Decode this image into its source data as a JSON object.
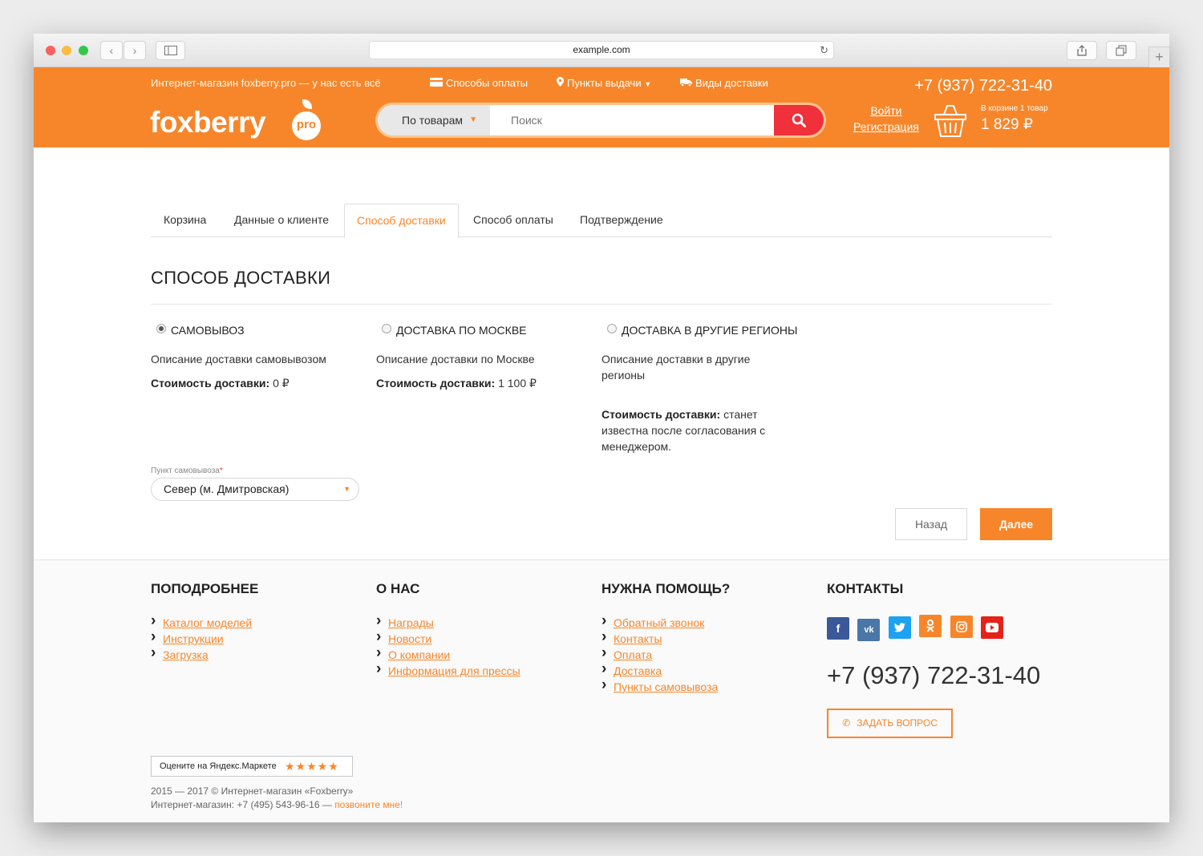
{
  "browser": {
    "url": "example.com"
  },
  "header": {
    "tagline": "Интернет-магазин foxberry.pro — у нас есть всё",
    "nav": {
      "payment": "Способы оплаты",
      "pickup": "Пункты выдачи",
      "delivery": "Виды доставки"
    },
    "phone": "+7 (937) 722-31-40",
    "logo": "foxberry",
    "logo_badge": "pro",
    "search": {
      "category": "По товарам",
      "placeholder": "Поиск"
    },
    "auth": {
      "login": "Войти",
      "register": "Регистрация"
    },
    "cart": {
      "label": "В корзине 1 товар",
      "sum": "1 829 ₽"
    }
  },
  "checkout": {
    "steps": [
      "Корзина",
      "Данные о клиенте",
      "Способ доставки",
      "Способ оплаты",
      "Подтверждение"
    ],
    "active_step": "Способ доставки",
    "heading": "СПОСОБ ДОСТАВКИ",
    "options": [
      {
        "title": "САМОВЫВОЗ",
        "selected": true,
        "description": "Описание доставки самовывозом",
        "cost_label": "Стоимость доставки:",
        "cost": "0 ₽"
      },
      {
        "title": "ДОСТАВКА ПО МОСКВЕ",
        "selected": false,
        "description": "Описание доставки по Москве",
        "cost_label": "Стоимость доставки:",
        "cost": "1 100 ₽"
      },
      {
        "title": "ДОСТАВКА В ДРУГИЕ РЕГИОНЫ",
        "selected": false,
        "description": "Описание доставки в другие регионы",
        "cost_label": "Стоимость доставки:",
        "cost": "станет известна после согласования с менеджером."
      }
    ],
    "pickup_label": "Пункт самовывоза",
    "pickup_required": "*",
    "pickup_value": "Север (м. Дмитровская)",
    "back_button": "Назад",
    "next_button": "Далее"
  },
  "footer": {
    "col1": {
      "title": "ПОПОДРОБНЕЕ",
      "links": [
        "Каталог моделей",
        "Инструкции",
        "Загрузка"
      ]
    },
    "col2": {
      "title": "О НАС",
      "links": [
        "Награды",
        "Новости",
        "О компании",
        "Информация для прессы"
      ]
    },
    "col3": {
      "title": "НУЖНА ПОМОЩЬ?",
      "links": [
        "Обратный звонок",
        "Контакты",
        "Оплата",
        "Доставка",
        "Пункты самовывоза"
      ]
    },
    "contacts": {
      "title": "КОНТАКТЫ",
      "socials": [
        "facebook",
        "vk",
        "twitter",
        "odnoklassniki",
        "instagram",
        "youtube"
      ],
      "phone": "+7 (937) 722-31-40",
      "ask_button": "ЗАДАТЬ ВОПРОС"
    },
    "rating_badge": "Оцените на Яндекс.Маркете",
    "rating_stars": "★★★★★",
    "copyright": "2015 — 2017 © Интернет-магазин «Foxberry»",
    "shop_phone": "Интернет-магазин: +7 (495) 543-96-16 —",
    "call_me": "позвоните мне!"
  },
  "colors": {
    "accent": "#f7862b",
    "search_button": "#f0303a"
  }
}
